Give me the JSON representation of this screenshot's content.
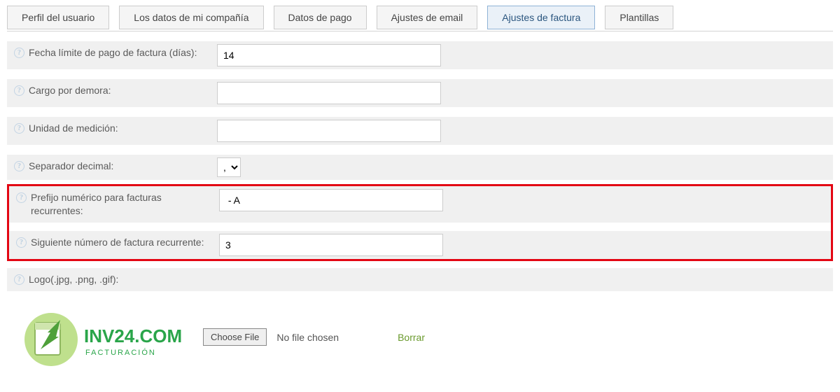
{
  "tabs": [
    {
      "label": "Perfil del usuario"
    },
    {
      "label": "Los datos de mi compañía"
    },
    {
      "label": "Datos de pago"
    },
    {
      "label": "Ajustes de email"
    },
    {
      "label": "Ajustes de factura"
    },
    {
      "label": "Plantillas"
    }
  ],
  "fields": {
    "payment_due_label": "Fecha límite de pago de factura (días):",
    "payment_due_value": "14",
    "late_fee_label": "Cargo por demora:",
    "late_fee_value": "",
    "unit_label": "Unidad de medición:",
    "unit_value": "",
    "decimal_sep_label": "Separador decimal:",
    "decimal_sep_value": ",",
    "prefix_label": "Prefijo numérico para facturas recurrentes:",
    "prefix_value": " - A",
    "next_number_label": "Siguiente número de factura recurrente:",
    "next_number_value": "3",
    "logo_label": "Logo(.jpg, .png, .gif):"
  },
  "file": {
    "choose_label": "Choose File",
    "no_file_label": "No file chosen",
    "delete_label": "Borrar"
  },
  "logo": {
    "brand_top": "INV24.COM",
    "brand_sub": "FACTURACIÓN"
  },
  "help_glyph": "?"
}
